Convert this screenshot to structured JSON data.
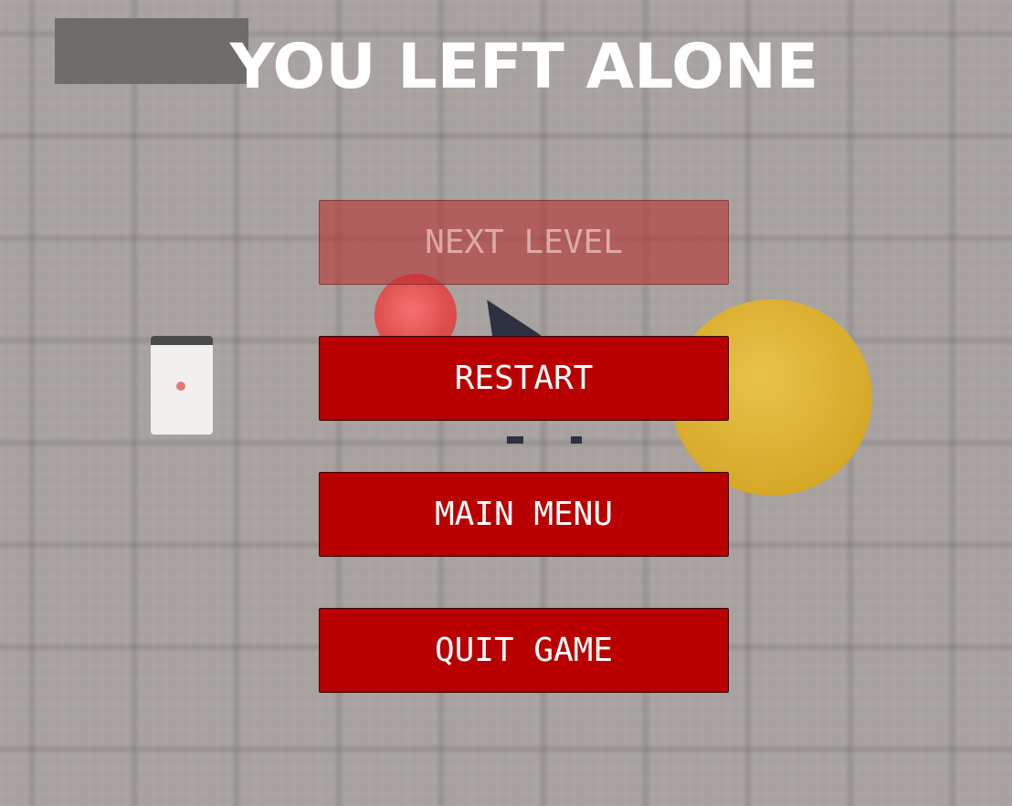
{
  "screen": {
    "title": "YOU LEFT ALONE"
  },
  "menu": {
    "next_level": {
      "label": "NEXT LEVEL",
      "enabled": false
    },
    "restart": {
      "label": "RESTART",
      "enabled": true
    },
    "main_menu": {
      "label": "MAIN MENU",
      "enabled": true
    },
    "quit_game": {
      "label": "QUIT GAME",
      "enabled": true
    }
  },
  "colors": {
    "button": "#b80000",
    "button_disabled": "#b82828",
    "title": "#ffffff",
    "floor": "#aaa5a2",
    "orb": "#e34343",
    "disc": "#d6a928"
  }
}
